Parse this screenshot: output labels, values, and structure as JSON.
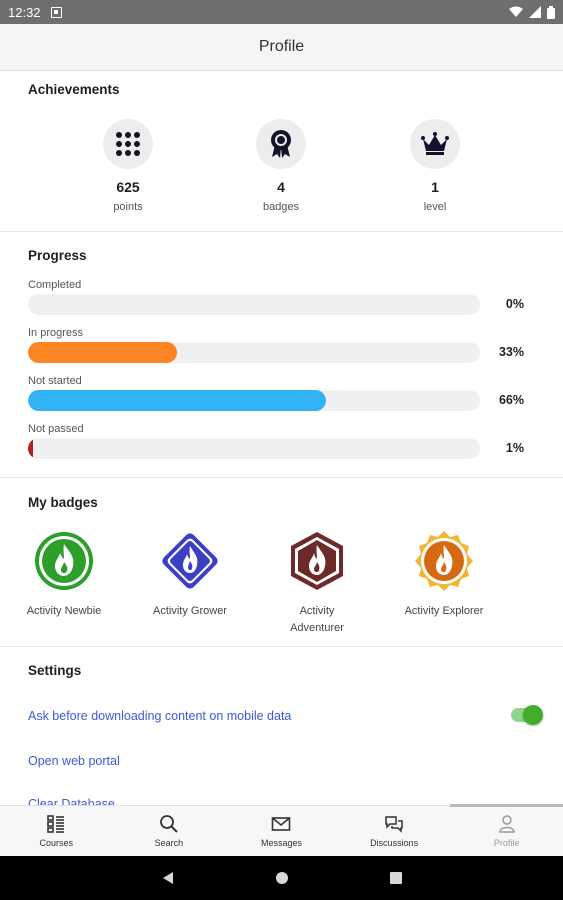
{
  "status_bar": {
    "time": "12:32"
  },
  "header": {
    "title": "Profile"
  },
  "achievements": {
    "title": "Achievements",
    "items": [
      {
        "value": "625",
        "label": "points",
        "icon": "grid-dots-icon"
      },
      {
        "value": "4",
        "label": "badges",
        "icon": "medal-icon"
      },
      {
        "value": "1",
        "label": "level",
        "icon": "crown-icon"
      }
    ]
  },
  "progress": {
    "title": "Progress",
    "rows": [
      {
        "label": "Completed",
        "percent_text": "0%",
        "fraction": 0.0,
        "color": "#f0f0f2"
      },
      {
        "label": "In progress",
        "percent_text": "33%",
        "fraction": 0.33,
        "color": "#fb8522"
      },
      {
        "label": "Not started",
        "percent_text": "66%",
        "fraction": 0.66,
        "color": "#31b3f6"
      },
      {
        "label": "Not passed",
        "percent_text": "1%",
        "fraction": 0.01,
        "color": "#b3211f"
      }
    ]
  },
  "badges": {
    "title": "My badges",
    "items": [
      {
        "label": "Activity Newbie",
        "color": "#2e9e2b",
        "shape": "circle"
      },
      {
        "label": "Activity Grower",
        "color": "#3b3fc4",
        "shape": "diamond"
      },
      {
        "label": "Activity Adventurer",
        "color": "#6e2a2a",
        "shape": "hexagon"
      },
      {
        "label": "Activity Explorer",
        "color": "#d66a12",
        "shape": "seal"
      }
    ]
  },
  "settings": {
    "title": "Settings",
    "items": [
      {
        "label": "Ask before downloading content on mobile data",
        "toggle_on": true
      },
      {
        "label": "Open web portal"
      },
      {
        "label": "Clear Database"
      }
    ]
  },
  "bottom_nav": [
    {
      "label": "Courses",
      "icon": "courses-icon"
    },
    {
      "label": "Search",
      "icon": "search-icon"
    },
    {
      "label": "Messages",
      "icon": "mail-icon"
    },
    {
      "label": "Discussions",
      "icon": "chat-bubbles-icon"
    },
    {
      "label": "Profile",
      "icon": "person-icon",
      "active": true
    }
  ],
  "colors": {
    "link": "#3c5bd6",
    "toggle_on": "#3fae2a"
  }
}
